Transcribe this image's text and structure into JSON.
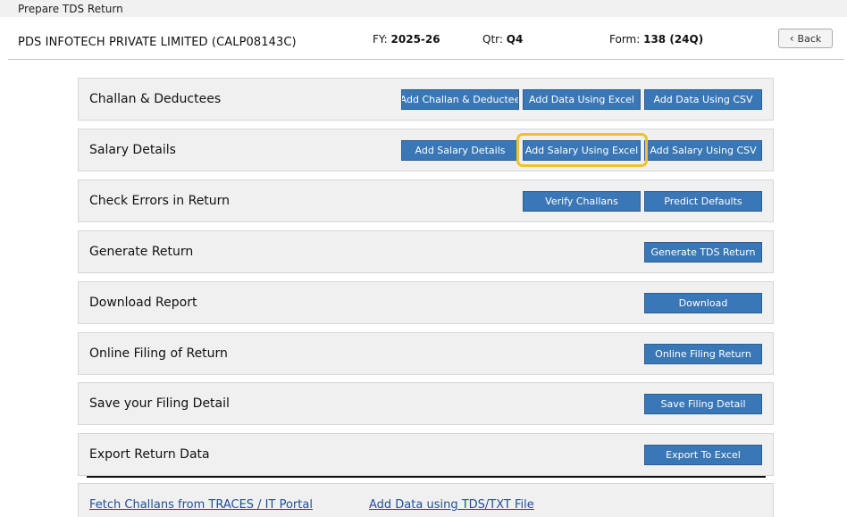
{
  "window": {
    "title": "Prepare TDS Return"
  },
  "header": {
    "company": "PDS INFOTECH PRIVATE LIMITED (CALP08143C)",
    "fy_label": "FY:",
    "fy_value": "2025-26",
    "qtr_label": "Qtr:",
    "qtr_value": "Q4",
    "form_label": "Form:",
    "form_value": "138 (24Q)",
    "back_label": "Back"
  },
  "sections": [
    {
      "label": "Challan & Deductees",
      "buttons": [
        "Add Challan & Deductee",
        "Add Data Using Excel",
        "Add Data Using CSV"
      ]
    },
    {
      "label": "Salary Details",
      "buttons": [
        "Add Salary Details",
        "Add Salary Using Excel",
        "Add Salary Using CSV"
      ]
    },
    {
      "label": "Check Errors in Return",
      "buttons": [
        "Verify Challans",
        "Predict Defaults"
      ]
    },
    {
      "label": "Generate Return",
      "buttons": [
        "Generate TDS Return"
      ]
    },
    {
      "label": "Download Report",
      "buttons": [
        "Download"
      ]
    },
    {
      "label": "Online Filing of Return",
      "buttons": [
        "Online Filing Return"
      ]
    },
    {
      "label": "Save your Filing Detail",
      "buttons": [
        "Save Filing Detail"
      ]
    },
    {
      "label": "Export Return Data",
      "buttons": [
        "Export To Excel"
      ]
    }
  ],
  "highlighted_button": "Add Salary Using Excel",
  "links": {
    "fetch_challans": "Fetch Challans from TRACES / IT Portal",
    "add_txt": "Add Data using TDS/TXT File"
  },
  "colors": {
    "button_bg": "#3a77b6",
    "highlight": "#f2c12e",
    "link": "#1f4e99"
  }
}
